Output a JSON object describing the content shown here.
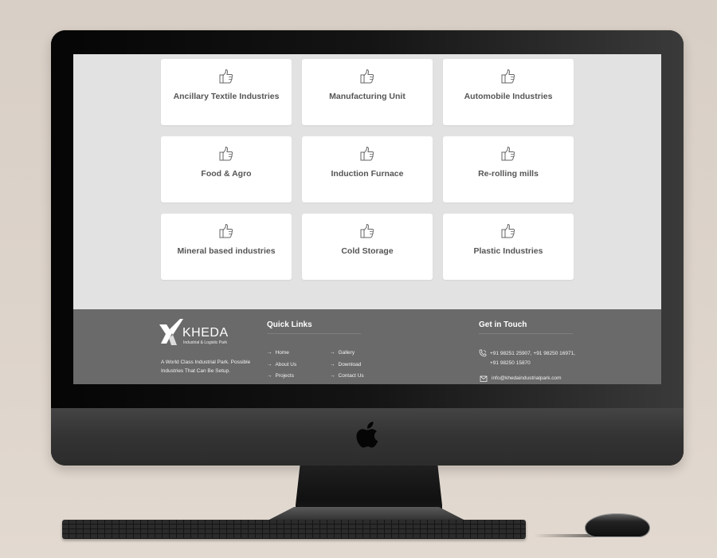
{
  "industries": [
    {
      "label": "Ancillary Textile Industries",
      "icon": "thumbs-up-icon"
    },
    {
      "label": "Manufacturing Unit",
      "icon": "thumbs-up-icon"
    },
    {
      "label": "Automobile Industries",
      "icon": "thumbs-up-icon"
    },
    {
      "label": "Food & Agro",
      "icon": "thumbs-up-icon"
    },
    {
      "label": "Induction Furnace",
      "icon": "thumbs-up-icon"
    },
    {
      "label": "Re-rolling mills",
      "icon": "thumbs-up-icon"
    },
    {
      "label": "Mineral based industries",
      "icon": "thumbs-up-icon"
    },
    {
      "label": "Cold Storage",
      "icon": "thumbs-up-icon"
    },
    {
      "label": "Plastic Industries",
      "icon": "thumbs-up-icon"
    }
  ],
  "footer": {
    "logo": {
      "name": "KHEDA",
      "subtitle": "Industrial & Logistic Park"
    },
    "tagline": "A World Class Industrial Park. Possible Industries That Can Be Setup.",
    "quick_links": {
      "title": "Quick Links",
      "arrow": "→",
      "items": [
        "Home",
        "About Us",
        "Projects",
        "Gallery",
        "Download",
        "Contact Us"
      ]
    },
    "contact": {
      "title": "Get in Touch",
      "phone_line1": "+91 98251 25907, +91 98250 16971,",
      "phone_line2": "+91 98250 15870",
      "email": "info@khedaindustrialpark.com"
    }
  },
  "colors": {
    "screen_bg": "#e2e2e2",
    "card_bg": "#ffffff",
    "footer_bg": "#6a6a6a",
    "card_text": "#555555"
  }
}
